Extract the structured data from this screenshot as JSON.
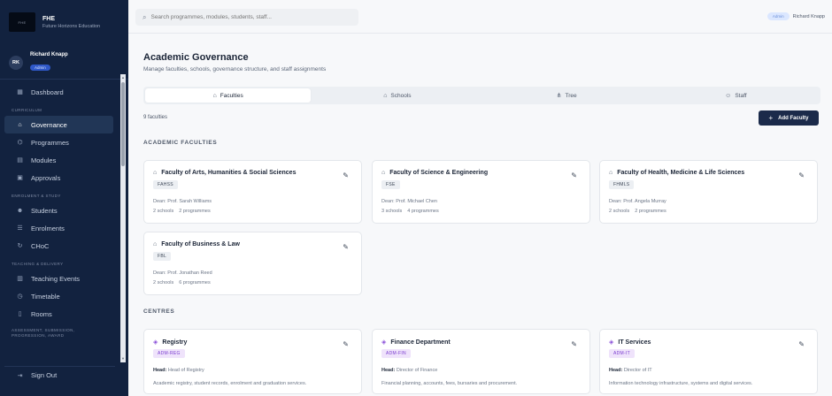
{
  "sidebar": {
    "brand_logo_text": "FHE",
    "brand_short": "FHE",
    "brand_full": "Future Horizons Education",
    "user_initials": "RK",
    "user_name": "Richard Knapp",
    "user_role": "Admin",
    "sections": {
      "curriculum": "CURRICULUM",
      "enrolment": "ENROLMENT & STUDY",
      "teaching": "TEACHING & DELIVERY",
      "assessment": "ASSESSMENT, SUBMISSION, PROGRESSION, AWARD"
    },
    "items": {
      "dashboard": "Dashboard",
      "governance": "Governance",
      "programmes": "Programmes",
      "modules": "Modules",
      "approvals": "Approvals",
      "students": "Students",
      "enrolments": "Enrolments",
      "choc": "CHoC",
      "teaching_events": "Teaching Events",
      "timetable": "Timetable",
      "rooms": "Rooms"
    },
    "sign_out": "Sign Out"
  },
  "topbar": {
    "search_placeholder": "Search programmes, modules, students, staff...",
    "user_badge": "Admin",
    "user_name": "Richard Knapp"
  },
  "page": {
    "title": "Academic Governance",
    "subtitle": "Manage faculties, schools, governance structure, and staff assignments",
    "tabs": [
      "Faculties",
      "Schools",
      "Tree",
      "Staff"
    ],
    "count": "9 faculties",
    "add_button": "Add Faculty",
    "faculties_heading": "ACADEMIC FACULTIES",
    "centres_heading": "CENTRES"
  },
  "faculties": [
    {
      "name": "Faculty of Arts, Humanities & Social Sciences",
      "code": "FAHSS",
      "dean": "Dean: Prof. Sarah Williams",
      "schools": "2 schools",
      "programmes": "2 programmes"
    },
    {
      "name": "Faculty of Science & Engineering",
      "code": "FSE",
      "dean": "Dean: Prof. Michael Chen",
      "schools": "3 schools",
      "programmes": "4 programmes"
    },
    {
      "name": "Faculty of Health, Medicine & Life Sciences",
      "code": "FHMLS",
      "dean": "Dean: Prof. Angela Murray",
      "schools": "2 schools",
      "programmes": "2 programmes"
    },
    {
      "name": "Faculty of Business & Law",
      "code": "FBL",
      "dean": "Dean: Prof. Jonathan Reed",
      "schools": "2 schools",
      "programmes": "6 programmes"
    }
  ],
  "centres": [
    {
      "name": "Registry",
      "code": "ADM-REG",
      "head_label": "Head:",
      "head": "Head of Registry",
      "desc": "Academic registry, student records, enrolment and graduation services."
    },
    {
      "name": "Finance Department",
      "code": "ADM-FIN",
      "head_label": "Head:",
      "head": "Director of Finance",
      "desc": "Financial planning, accounts, fees, bursaries and procurement."
    },
    {
      "name": "IT Services",
      "code": "ADM-IT",
      "head_label": "Head:",
      "head": "Director of IT",
      "desc": "Information technology infrastructure, systems and digital services."
    }
  ]
}
